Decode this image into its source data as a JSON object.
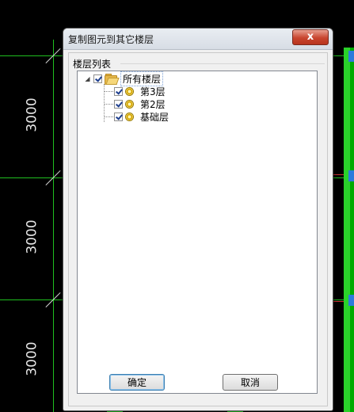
{
  "background": {
    "dimension_labels": [
      "3000",
      "3000",
      "3000"
    ]
  },
  "dialog": {
    "title": "复制图元到其它楼层",
    "close_label": "x",
    "group_label": "楼层列表",
    "tree": {
      "root": {
        "label": "所有楼层",
        "checked": true,
        "expanded": true
      },
      "children": [
        {
          "label": "第3层",
          "checked": true
        },
        {
          "label": "第2层",
          "checked": true
        },
        {
          "label": "基础层",
          "checked": true
        }
      ]
    },
    "ok_label": "确定",
    "cancel_label": "取消"
  },
  "colors": {
    "cad_green": "#1fbf1f",
    "dialog_bg": "#f0f0f0",
    "close_red": "#c8452e"
  }
}
